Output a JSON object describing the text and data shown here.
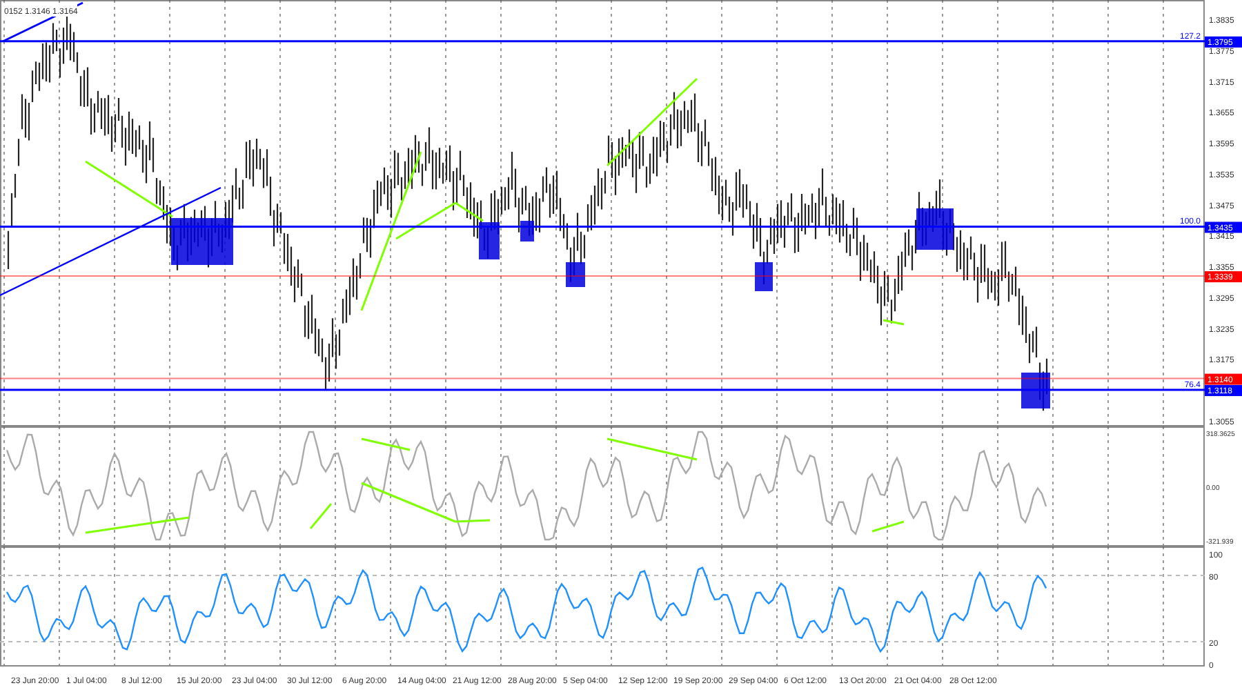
{
  "chart_header": "0152 1.3146 1.3164",
  "price_pane": {
    "ticks": [
      "1.3835",
      "1.3775",
      "1.3715",
      "1.3655",
      "1.3595",
      "1.3535",
      "1.3475",
      "1.3415",
      "1.3355",
      "1.3295",
      "1.3235",
      "1.3175",
      "1.3055"
    ],
    "levels": [
      {
        "price": "1.3795",
        "color": "#0000ff",
        "fib": "127.2"
      },
      {
        "price": "1.3435",
        "color": "#0000ff",
        "fib": "100.0"
      },
      {
        "price": "1.3339",
        "color": "#ff0000"
      },
      {
        "price": "1.3140",
        "color": "#ff0000"
      },
      {
        "price": "1.3118",
        "color": "#0000ff",
        "fib": "76.4"
      }
    ]
  },
  "cci_pane": {
    "ticks": [
      "318.3625",
      "0.00",
      "-321.939"
    ]
  },
  "rsi_pane": {
    "ticks": [
      "100",
      "80",
      "20",
      "0"
    ]
  },
  "time_axis": [
    "23 Jun 20:00",
    "1 Jul 04:00",
    "8 Jul 12:00",
    "15 Jul 20:00",
    "23 Jul 04:00",
    "30 Jul 12:00",
    "6 Aug 20:00",
    "14 Aug 04:00",
    "21 Aug 12:00",
    "28 Aug 20:00",
    "5 Sep 04:00",
    "12 Sep 12:00",
    "19 Sep 20:00",
    "29 Sep 04:00",
    "6 Oct 12:00",
    "13 Oct 20:00",
    "21 Oct 04:00",
    "28 Oct 12:00"
  ]
}
